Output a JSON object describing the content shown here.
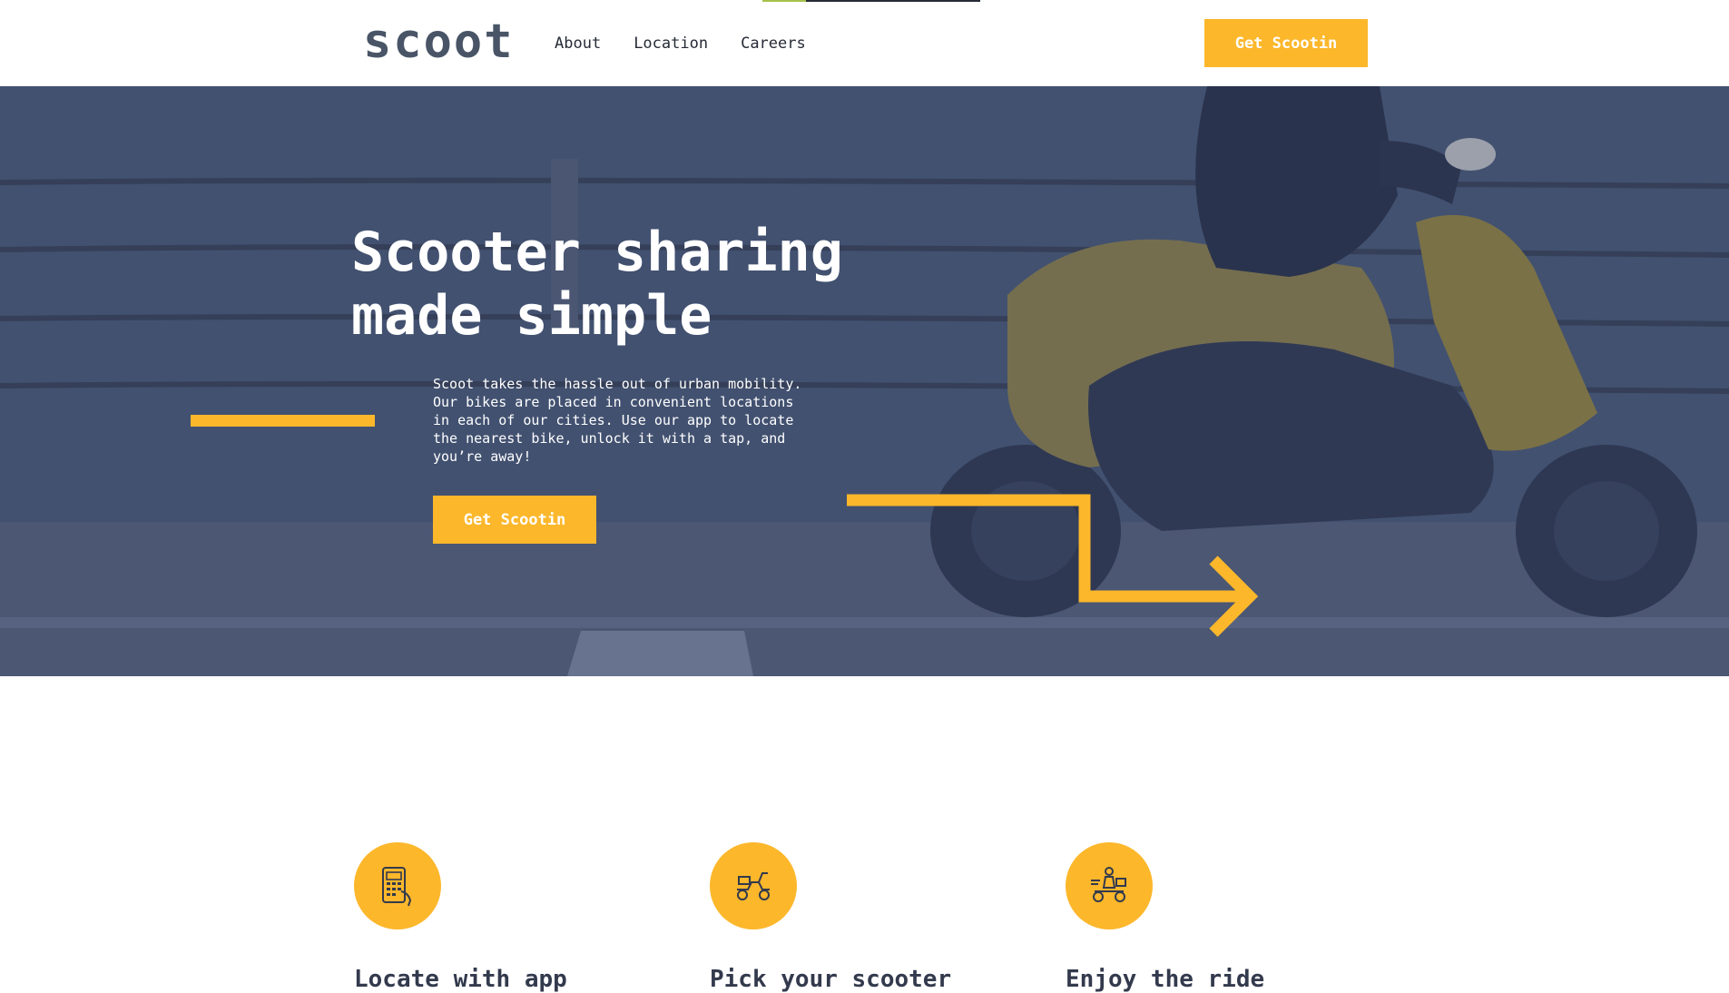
{
  "header": {
    "logo": "scoot",
    "nav": [
      "About",
      "Location",
      "Careers"
    ],
    "cta_label": "Get Scootin"
  },
  "hero": {
    "title": "Scooter sharing made simple",
    "description": "Scoot takes the hassle out of urban mobility. Our bikes are placed in convenient locations in each of our cities. Use our app to locate the nearest bike, unlock it with a tap, and you’re away!",
    "cta_label": "Get Scootin"
  },
  "features": [
    {
      "title": "Locate with app",
      "icon": "phone-app-icon"
    },
    {
      "title": "Pick your scooter",
      "icon": "scooter-icon"
    },
    {
      "title": "Enjoy the ride",
      "icon": "rider-icon"
    }
  ],
  "colors": {
    "accent": "#fcb72b",
    "dark": "#333a4d",
    "logo": "#495567"
  }
}
